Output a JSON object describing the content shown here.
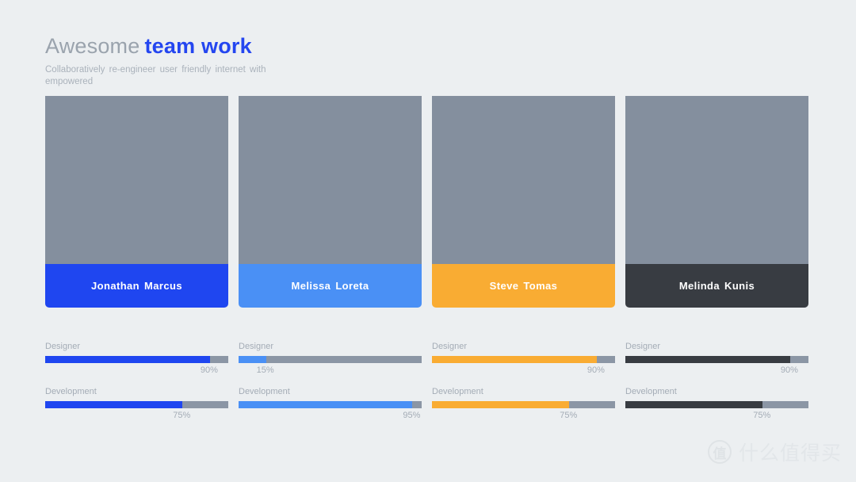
{
  "background_color": "#eceff1",
  "header": {
    "title_light": "Awesome",
    "title_accent": "team work",
    "title_light_color": "#9aa3ad",
    "title_accent_color": "#2446f0",
    "subtitle": "Collaboratively re-engineer user friendly internet with empowered"
  },
  "photo_placeholder_color": "#848f9e",
  "bar_track_color": "#8b96a5",
  "cards": [
    {
      "name": "Jonathan Marcus",
      "accent_color": "#1f46f0",
      "skills": [
        {
          "label": "Designer",
          "value": 90,
          "value_text": "90%"
        },
        {
          "label": "Development",
          "value": 75,
          "value_text": "75%"
        }
      ]
    },
    {
      "name": "Melissa Loreta",
      "accent_color": "#4a90f5",
      "skills": [
        {
          "label": "Designer",
          "value": 15,
          "value_text": "15%"
        },
        {
          "label": "Development",
          "value": 95,
          "value_text": "95%"
        }
      ]
    },
    {
      "name": "Steve Tomas",
      "accent_color": "#f9ac33",
      "skills": [
        {
          "label": "Designer",
          "value": 90,
          "value_text": "90%"
        },
        {
          "label": "Development",
          "value": 75,
          "value_text": "75%"
        }
      ]
    },
    {
      "name": "Melinda Kunis",
      "accent_color": "#383c42",
      "skills": [
        {
          "label": "Designer",
          "value": 90,
          "value_text": "90%"
        },
        {
          "label": "Development",
          "value": 75,
          "value_text": "75%"
        }
      ]
    }
  ],
  "watermark": {
    "logo_char": "值",
    "text": "什么值得买"
  }
}
